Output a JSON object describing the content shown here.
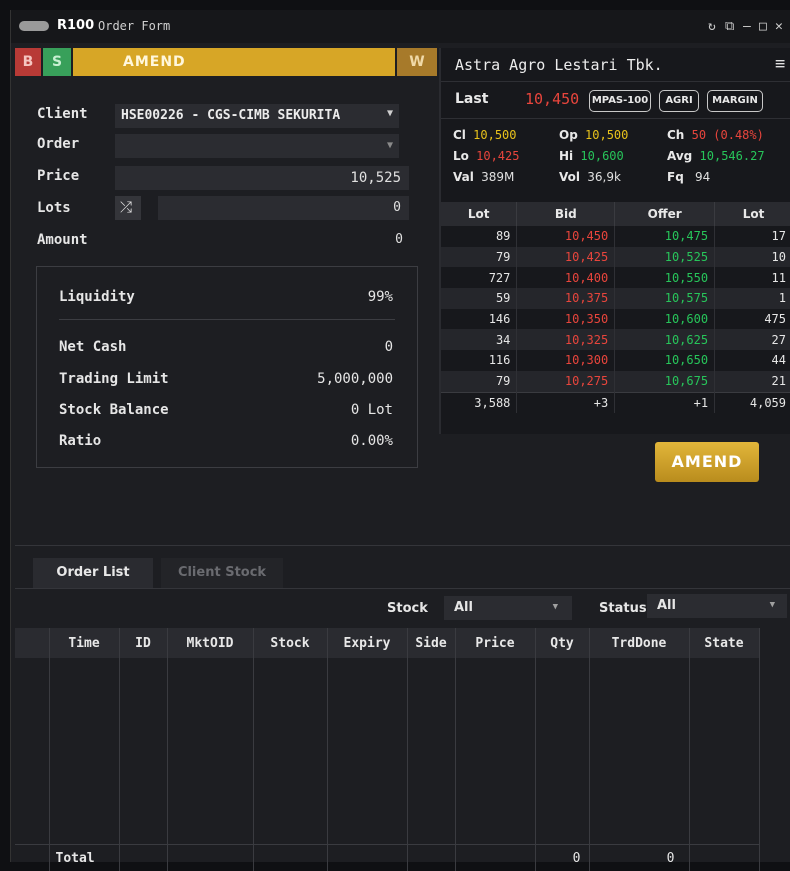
{
  "window": {
    "code": "R100",
    "title": "Order Form"
  },
  "side_tabs": {
    "buy": "B",
    "sell": "S",
    "mode": "AMEND",
    "withdraw": "W"
  },
  "form": {
    "client_label": "Client",
    "client_value": "HSE00226 - CGS-CIMB SEKURITA",
    "order_label": "Order",
    "order_value": "",
    "price_label": "Price",
    "price_value": "10,525",
    "lots_label": "Lots",
    "lots_value": "0",
    "amount_label": "Amount",
    "amount_value": "0"
  },
  "summary": {
    "liquidity_label": "Liquidity",
    "liquidity_value": "99%",
    "netcash_label": "Net Cash",
    "netcash_value": "0",
    "tradinglimit_label": "Trading Limit",
    "tradinglimit_value": "5,000,000",
    "stockbalance_label": "Stock Balance",
    "stockbalance_value": "0 Lot",
    "ratio_label": "Ratio",
    "ratio_value": "0.00%"
  },
  "quote": {
    "name": "Astra Agro Lestari Tbk.",
    "last_label": "Last",
    "last_value": "10,450",
    "chips": [
      "MPAS-100",
      "AGRI",
      "MARGIN"
    ],
    "cl_label": "Cl",
    "cl_value": "10,500",
    "op_label": "Op",
    "op_value": "10,500",
    "ch_label": "Ch",
    "ch_value": "50 (0.48%)",
    "lo_label": "Lo",
    "lo_value": "10,425",
    "hi_label": "Hi",
    "hi_value": "10,600",
    "avg_label": "Avg",
    "avg_value": "10,546.27",
    "val_label": "Val",
    "val_value": "389M",
    "vol_label": "Vol",
    "vol_value": "36,9k",
    "fq_label": "Fq",
    "fq_value": "94",
    "colors": {
      "up": "#27c55a",
      "down": "#e8453c",
      "flat": "#e8c21b"
    }
  },
  "orderbook": {
    "headers": [
      "Lot",
      "Bid",
      "Offer",
      "Lot"
    ],
    "rows": [
      [
        "89",
        "10,450",
        "10,475",
        "17"
      ],
      [
        "79",
        "10,425",
        "10,525",
        "10"
      ],
      [
        "727",
        "10,400",
        "10,550",
        "11"
      ],
      [
        "59",
        "10,375",
        "10,575",
        "1"
      ],
      [
        "146",
        "10,350",
        "10,600",
        "475"
      ],
      [
        "34",
        "10,325",
        "10,625",
        "27"
      ],
      [
        "116",
        "10,300",
        "10,650",
        "44"
      ],
      [
        "79",
        "10,275",
        "10,675",
        "21"
      ]
    ],
    "totals": [
      "3,588",
      "+3",
      "+1",
      "4,059"
    ]
  },
  "amend_button": "AMEND",
  "tabs": {
    "order_list": "Order List",
    "client_stock": "Client Stock"
  },
  "filters": {
    "stock_label": "Stock",
    "stock_value": "All",
    "status_label": "Status",
    "status_value": "All"
  },
  "orders_table": {
    "headers": [
      "Time",
      "ID",
      "MktOID",
      "Stock",
      "Expiry",
      "Side",
      "Price",
      "Qty",
      "TrdDone",
      "State"
    ],
    "total_label": "Total",
    "total_qty": "0",
    "total_trddone": "0"
  }
}
